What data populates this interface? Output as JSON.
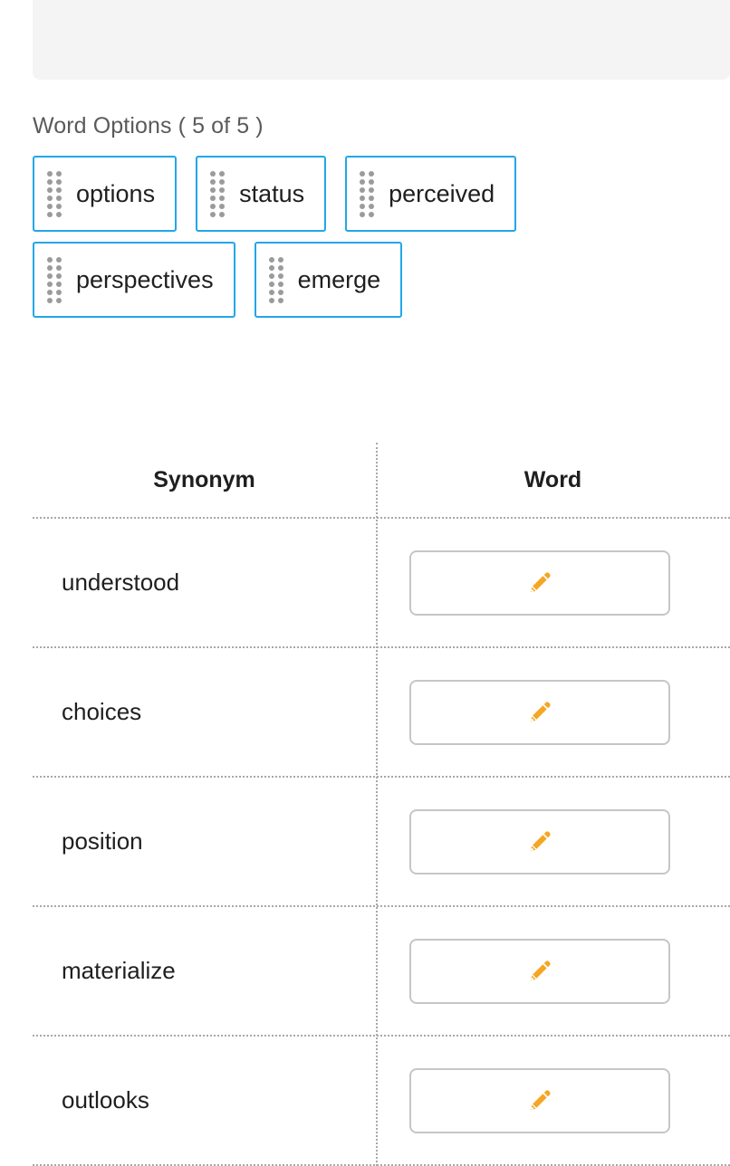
{
  "top_panel": {
    "content": ""
  },
  "word_options": {
    "title": "Word Options ( 5 of 5 )",
    "count_available": 5,
    "count_total": 5,
    "handle_icon": "drag-handle-icon",
    "chips": [
      {
        "label": "options"
      },
      {
        "label": "status"
      },
      {
        "label": "perceived"
      },
      {
        "label": "perspectives"
      },
      {
        "label": "emerge"
      }
    ]
  },
  "match_table": {
    "headers": {
      "synonym": "Synonym",
      "word": "Word"
    },
    "drop_icon": "pencil-icon",
    "rows": [
      {
        "synonym": "understood",
        "word": ""
      },
      {
        "synonym": "choices",
        "word": ""
      },
      {
        "synonym": "position",
        "word": ""
      },
      {
        "synonym": "materialize",
        "word": ""
      },
      {
        "synonym": "outlooks",
        "word": ""
      }
    ]
  },
  "colors": {
    "chip_border": "#22a7e8",
    "pencil": "#f5a623",
    "panel_background": "#f4f4f4",
    "divider": "#a8a8a8",
    "drop_border": "#c6c6c6",
    "title_text": "#5a5a5a",
    "body_text": "#1f1f1f"
  }
}
